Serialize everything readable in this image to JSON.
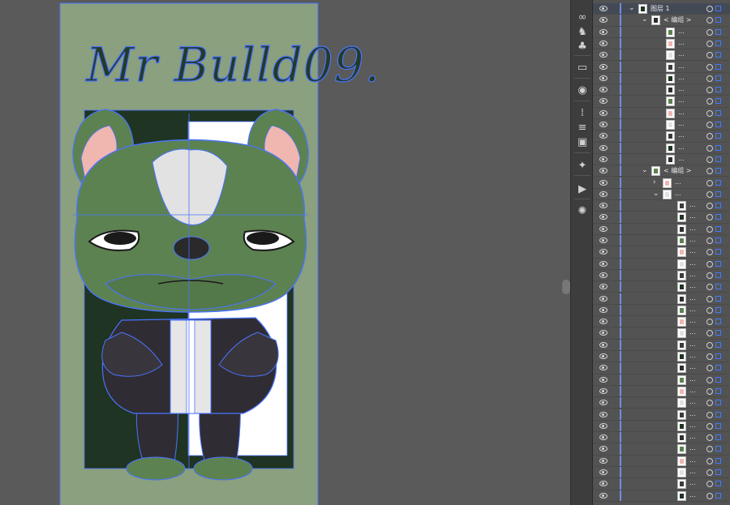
{
  "canvas": {
    "title_art_text": "Mr Bulld09."
  },
  "layers_panel": {
    "layer": {
      "name": "图层 1"
    },
    "group_label": "< 编组 >",
    "ellipsis": "...",
    "visible_icon": "eye-icon",
    "expand_icon": "chevron-icon"
  },
  "tools": [
    "link-icon",
    "puppet-icon",
    "symbol-sprayer-icon",
    "club-icon",
    "gradient-icon",
    "color-wheel-icon",
    "align-icon",
    "align-left-icon",
    "pathfinder-icon",
    "magic-wand-icon",
    "play-icon",
    "sun-icon"
  ],
  "colors": {
    "selection": "#3f7bff",
    "artboard_bg": "#8aa07e",
    "dog_green": "#5c8251",
    "suit": "#2f2c33",
    "dark_bg": "#1f3422",
    "ear_pink": "#f0b6b0"
  }
}
